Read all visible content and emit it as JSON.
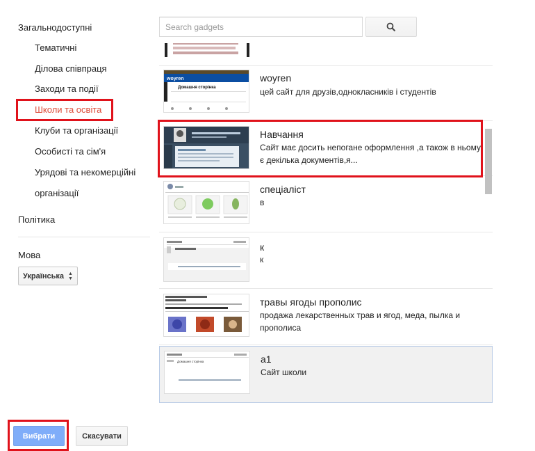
{
  "sidebar": {
    "public": "Загальнодоступні",
    "categories": [
      "Тематичні",
      "Ділова співпраця",
      "Заходи та події",
      "Школи та освіта",
      "Клуби та організації",
      "Особисті та сім'я",
      "Урядові та некомерційні",
      "організації"
    ],
    "selected_index": 3,
    "policy": "Політика",
    "language_label": "Мова",
    "language_value": "Українська"
  },
  "search": {
    "placeholder": "Search gadgets",
    "button_icon": "search-icon"
  },
  "results": [
    {
      "title": "",
      "desc": ""
    },
    {
      "title": "woyren",
      "desc": "цей сайт для друзів,однокласників і студентів"
    },
    {
      "title": "Навчання",
      "desc": "Сайт має досить непогане оформлення ,а також в ньому є декілька документів,я..."
    },
    {
      "title": "спеціаліст",
      "desc": "в"
    },
    {
      "title": "к",
      "desc": "к"
    },
    {
      "title": "травы ягоды прополис",
      "desc": "продажа лекарственных трав и ягод, меда, пылка и прополиса"
    },
    {
      "title": "а1",
      "desc": "Сайт школи"
    }
  ],
  "thumbnails": {
    "woyren_header": "woyren",
    "woyren_page": "Домашня сторінка",
    "a1_page": "Домашня сторінка"
  },
  "colors": {
    "highlight": "#e0121b",
    "selected_category": "#dd4b39",
    "primary_button": "#7fadf9"
  },
  "footer": {
    "select_label": "Вибрати",
    "cancel_label": "Скасувати"
  }
}
